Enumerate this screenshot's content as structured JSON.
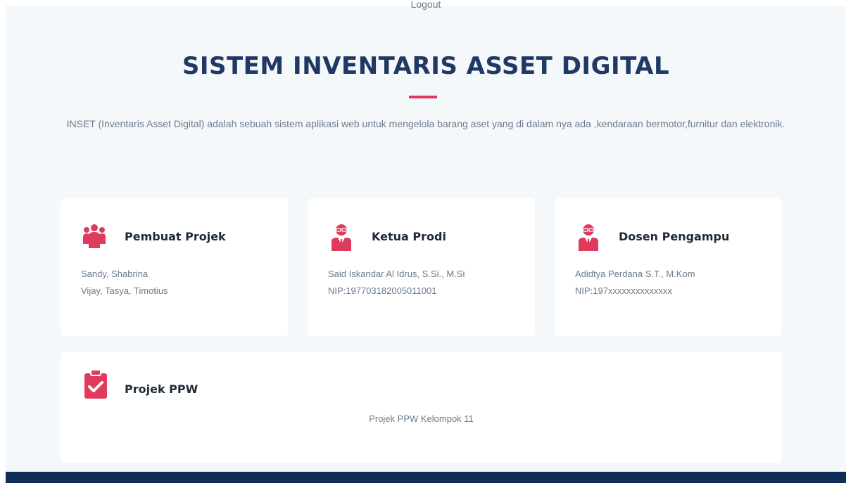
{
  "header": {
    "cropped_text": "Logout",
    "title": "SISTEM INVENTARIS ASSET DIGITAL",
    "description": "INSET (Inventaris Asset Digital) adalah sebuah sistem aplikasi web untuk mengelola barang aset yang di dalam nya ada ,kendaraan bermotor,furnitur dan elektronik."
  },
  "cards": [
    {
      "icon": "group-icon",
      "title": "Pembuat Projek",
      "lines": [
        "Sandy, Shabrina",
        "Vijay, Tasya, Timotius"
      ]
    },
    {
      "icon": "person-tie-icon",
      "title": "Ketua Prodi",
      "lines": [
        "Said Iskandar Al Idrus, S.Si., M.Si",
        "NIP:197703182005011001"
      ]
    },
    {
      "icon": "person-tie-icon",
      "title": "Dosen Pengampu",
      "lines": [
        "Adidtya Perdana S.T., M.Kom",
        "NIP:197xxxxxxxxxxxxxx"
      ]
    }
  ],
  "project_card": {
    "icon": "clipboard-check-icon",
    "title": "Projek PPW",
    "text": "Projek PPW Kelompok 11"
  },
  "colors": {
    "accent": "#e03a5d",
    "title": "#1f3864",
    "background": "#f4f8fb",
    "footer": "#0f2d57"
  }
}
